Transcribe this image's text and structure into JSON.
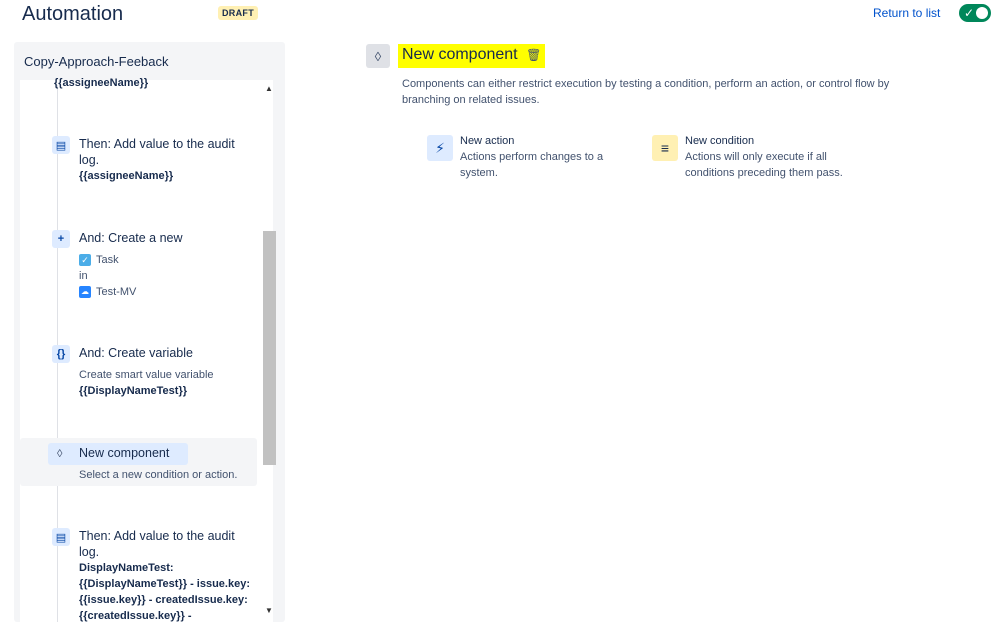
{
  "header": {
    "title": "Automation",
    "badge": "DRAFT",
    "return_link": "Return to list",
    "toggle_check": "✓"
  },
  "panel": {
    "title": "Copy-Approach-Feeback",
    "cut_text": "{{assigneeName}}",
    "steps": [
      {
        "icon": "▤",
        "icon_name": "audit-log-icon",
        "head": "Then: Add value to the audit log.",
        "bold": "{{assigneeName}}"
      },
      {
        "icon": "+",
        "icon_name": "plus-icon",
        "head": "And: Create a new",
        "task_label": "Task",
        "in_label": "in",
        "project_label": "Test-MV"
      },
      {
        "icon": "{}",
        "icon_name": "braces-icon",
        "head": "And: Create variable",
        "small": "Create smart value variable",
        "bold": "{{DisplayNameTest}}"
      },
      {
        "icon": "◊",
        "icon_name": "branch-icon",
        "head": "New component",
        "small": "Select a new condition or action."
      },
      {
        "icon": "▤",
        "icon_name": "audit-log-icon",
        "head": "Then: Add value to the audit log.",
        "bold": "DisplayNameTest: {{DisplayNameTest}} - issue.key: {{issue.key}} - createdIssue.key: {{createdIssue.key}} -"
      }
    ]
  },
  "main": {
    "icon": "◊",
    "title": "New component",
    "trash_icon": "🗑",
    "description": "Components can either restrict execution by testing a condition, perform an action, or control flow by branching on related issues.",
    "options": [
      {
        "icon": "⚡",
        "title": "New action",
        "description": "Actions perform changes to a system.",
        "icon_bg": "#deebff",
        "icon_color": "#0747a6"
      },
      {
        "icon": "≡",
        "title": "New condition",
        "description": "Actions will only execute if all conditions preceding them pass.",
        "icon_bg": "#fff0b3",
        "icon_color": "#172b4d"
      }
    ]
  },
  "colors": {
    "accent": "#0052cc",
    "toggle_on": "#00875a",
    "highlight": "#ffff00"
  }
}
